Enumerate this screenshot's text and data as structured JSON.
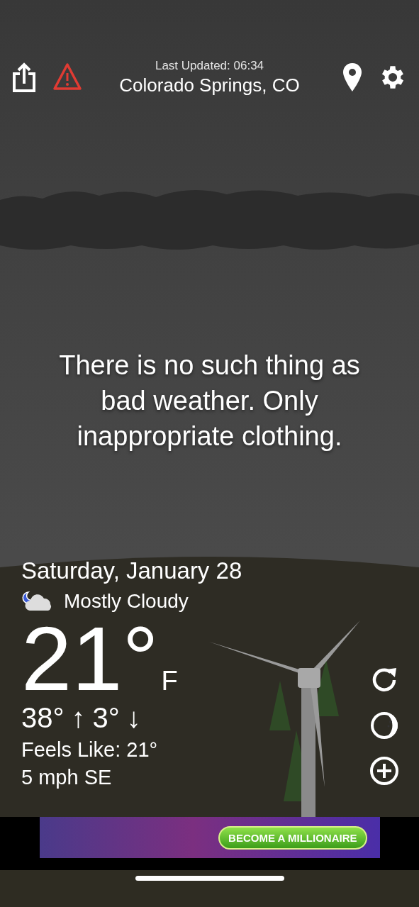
{
  "header": {
    "last_updated": "Last Updated: 06:34",
    "location": "Colorado Springs, CO"
  },
  "quote": "There is no such thing as bad weather. Only inappropriate clothing.",
  "current": {
    "date": "Saturday, January 28",
    "condition": "Mostly Cloudy",
    "temperature": "21°",
    "unit": "F",
    "high": "38°",
    "high_arrow": "↑",
    "low": "3°",
    "low_arrow": "↓",
    "feels_like": "Feels Like: 21°",
    "wind": "5 mph SE"
  },
  "ad": {
    "button_label": "BECOME A MILLIONAIRE"
  }
}
